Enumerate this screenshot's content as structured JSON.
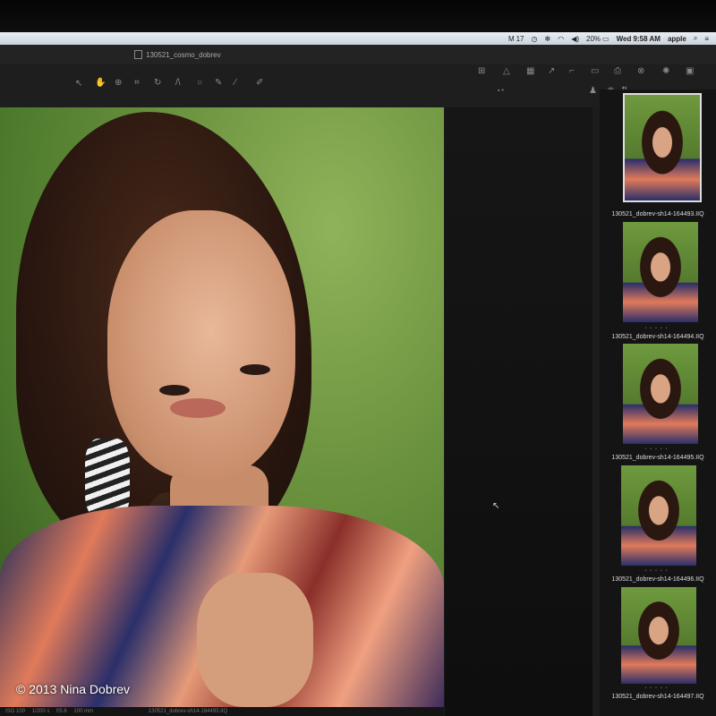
{
  "menubar": {
    "battery_pct": "20%",
    "clock": "Wed 9:58 AM",
    "user": "apple",
    "mail_count": "17"
  },
  "window": {
    "title": "130521_cosmo_dobrev"
  },
  "viewer": {
    "status": [
      "ISO 100",
      "1/200 s",
      "f/5.6",
      "100 mm",
      "130521_dobrev-sh14-164493.IIQ"
    ],
    "copyright": "© 2013 Nina Dobrev"
  },
  "browser": {
    "thumbnails": [
      {
        "caption": "130521_dobrev-sh14-164493.IIQ",
        "selected": true
      },
      {
        "caption": "130521_dobrev-sh14-164494.IIQ",
        "selected": false
      },
      {
        "caption": "130521_dobrev-sh14-164495.IIQ",
        "selected": false
      },
      {
        "caption": "130521_dobrev-sh14-164496.IIQ",
        "selected": false
      },
      {
        "caption": "130521_dobrev-sh14-164497.IIQ",
        "selected": false
      }
    ]
  },
  "icons": {
    "tools": [
      "pointer-icon",
      "hand-icon",
      "zoom-icon",
      "crop-icon",
      "rotate-icon",
      "straighten-icon",
      "circle-icon",
      "brush-icon",
      "eyedropper-icon",
      "picker-icon"
    ],
    "right_tools": [
      "grid-icon",
      "warning-icon",
      "layout-icon",
      "arrow-icon",
      "tag-icon",
      "print-icon",
      "process-icon",
      "settings-icon",
      "image-icon",
      "fullscreen-icon"
    ]
  },
  "colors": {
    "active_tool": "#e04020",
    "selected_outline": "#dddddd"
  }
}
